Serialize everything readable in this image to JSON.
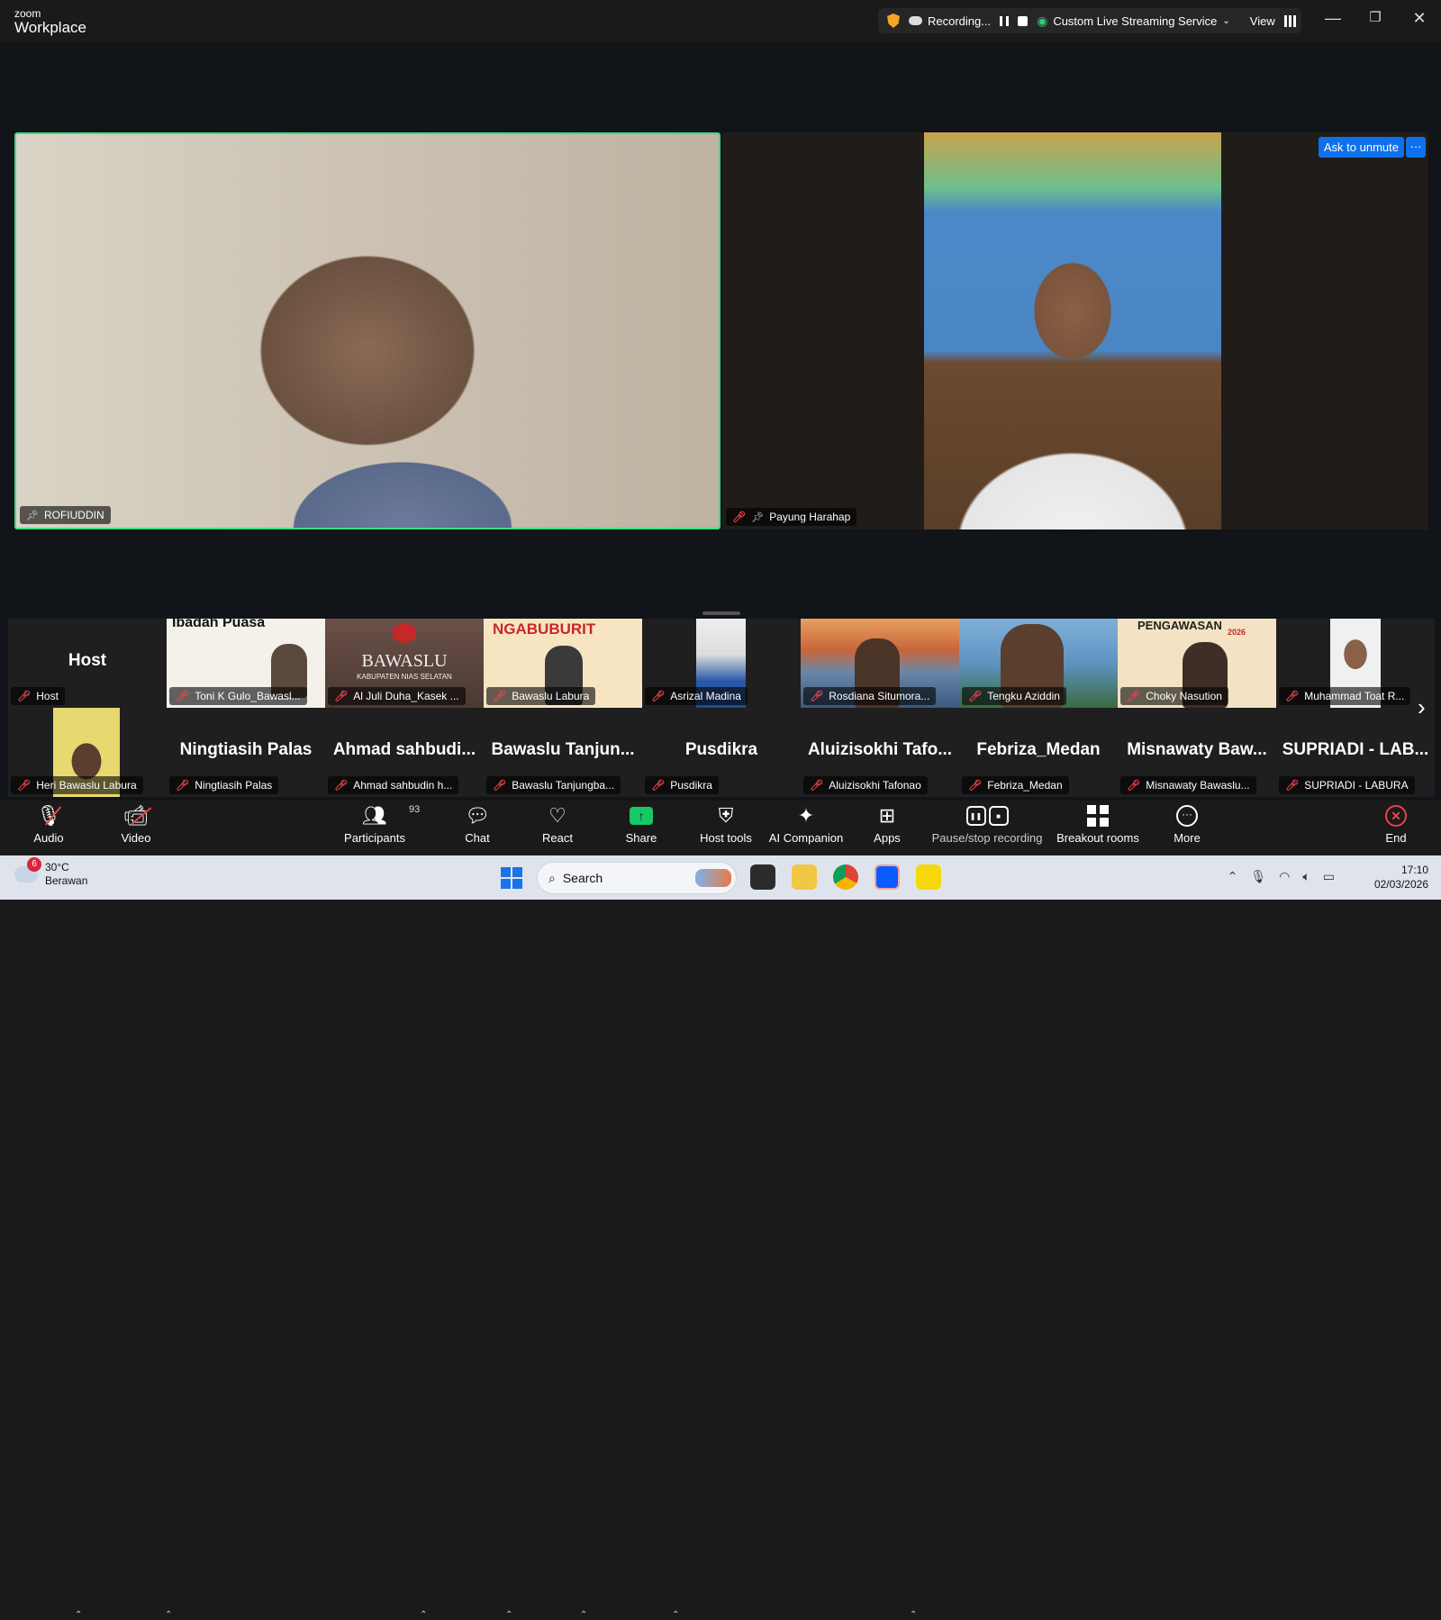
{
  "app": {
    "logo_top": "zoom",
    "logo_bottom": "Workplace"
  },
  "status_bar": {
    "recording_label": "Recording...",
    "stream_label": "Custom Live Streaming Service",
    "view_label": "View"
  },
  "main_video": {
    "name": "ROFIUDDIN"
  },
  "side_video": {
    "name": "Payung Harahap",
    "ask_unmute": "Ask to unmute",
    "more": "···"
  },
  "gallery": {
    "row1": [
      {
        "big": "Host",
        "name": "Host"
      },
      {
        "name": "Toni K Gulo_Bawasl..."
      },
      {
        "name": "Al Juli Duha_Kasek ..."
      },
      {
        "name": "Bawaslu Labura"
      },
      {
        "name": "Asrizal Madina"
      },
      {
        "name": "Rosdiana Situmora..."
      },
      {
        "name": "Tengku Aziddin"
      },
      {
        "name": "Choky Nasution"
      },
      {
        "name": "Muhammad Toat R..."
      }
    ],
    "row2": [
      {
        "big": "",
        "name": "Heri Bawaslu Labura"
      },
      {
        "big": "Ningtiasih Palas",
        "name": "Ningtiasih Palas"
      },
      {
        "big": "Ahmad sahbudi...",
        "name": "Ahmad sahbudin h..."
      },
      {
        "big": "Bawaslu Tanjun...",
        "name": "Bawaslu Tanjungba..."
      },
      {
        "big": "Pusdikra",
        "name": "Pusdikra"
      },
      {
        "big": "Aluizisokhi Tafo...",
        "name": "Aluizisokhi Tafonao"
      },
      {
        "big": "Febriza_Medan",
        "name": "Febriza_Medan"
      },
      {
        "big": "Misnawaty Baw...",
        "name": "Misnawaty Bawaslu..."
      },
      {
        "big": "SUPRIADI - LAB...",
        "name": "SUPRIADI - LABURA"
      }
    ],
    "thumb_texts": {
      "toni_banner": "Ibadah Puasa",
      "bawaslu_logo": "BAWASLU",
      "bawaslu_sub": "KABUPATEN NIAS SELATAN",
      "ngabuburit": "NGABUBURIT",
      "pengawasan": "PENGAWASAN",
      "year": "2026"
    }
  },
  "toolbar": {
    "audio": "Audio",
    "video": "Video",
    "participants": "Participants",
    "participants_count": "93",
    "chat": "Chat",
    "react": "React",
    "share": "Share",
    "host_tools": "Host tools",
    "ai_companion": "AI Companion",
    "apps": "Apps",
    "pause_recording": "Pause/stop recording",
    "breakout": "Breakout rooms",
    "more": "More",
    "end": "End"
  },
  "taskbar": {
    "weather_temp": "30°C",
    "weather_desc": "Berawan",
    "weather_badge": "6",
    "search_placeholder": "Search",
    "time": "17:10",
    "date": "02/03/2026"
  },
  "colors": {
    "active_speaker_border": "#3ddc84",
    "muted_icon": "#e8434c",
    "accent_blue": "#0e71eb",
    "share_green": "#17c964"
  }
}
